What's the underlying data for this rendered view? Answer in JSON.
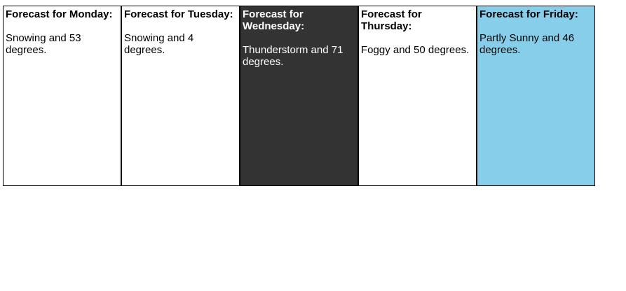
{
  "forecasts": [
    {
      "title": "Forecast for Monday:",
      "description": "Snowing and 53 degrees.",
      "background": "#ffffff",
      "text_color": "#000000"
    },
    {
      "title": "Forecast for Tuesday:",
      "description": "Snowing and 4 degrees.",
      "background": "#ffffff",
      "text_color": "#000000"
    },
    {
      "title": "Forecast for Wednesday:",
      "description": "Thunderstorm and 71 degrees.",
      "background": "#333333",
      "text_color": "#ffffff"
    },
    {
      "title": "Forecast for Thursday:",
      "description": "Foggy and 50 degrees.",
      "background": "#ffffff",
      "text_color": "#000000"
    },
    {
      "title": "Forecast for Friday:",
      "description": "Partly Sunny and 46 degrees.",
      "background": "#87ceeb",
      "text_color": "#000000"
    }
  ]
}
